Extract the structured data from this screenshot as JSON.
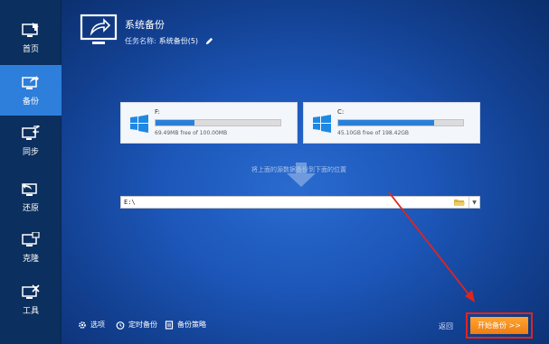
{
  "sidebar": {
    "items": [
      {
        "label": "首页",
        "icon": "home-monitor-icon",
        "active": false
      },
      {
        "label": "备份",
        "icon": "backup-icon",
        "active": true
      },
      {
        "label": "同步",
        "icon": "sync-icon",
        "active": false
      },
      {
        "label": "还原",
        "icon": "restore-icon",
        "active": false
      },
      {
        "label": "克隆",
        "icon": "clone-icon",
        "active": false
      },
      {
        "label": "工具",
        "icon": "tools-icon",
        "active": false
      }
    ]
  },
  "header": {
    "title": "系统备份",
    "task_name_label": "任务名称:",
    "task_name_value": "系统备份(5)"
  },
  "sources": [
    {
      "letter": "F:",
      "free_text": "69.49MB free of 100.00MB",
      "used_fraction": 0.31
    },
    {
      "letter": "C:",
      "free_text": "45.10GB free of 198.42GB",
      "used_fraction": 0.77
    }
  ],
  "hint": "将上面的源数据备份到下面的位置",
  "destination": {
    "path": "E:\\"
  },
  "bottom": {
    "options_label": "选项",
    "schedule_label": "定时备份",
    "strategy_label": "备份策略",
    "back_label": "返回",
    "start_label": "开始备份 >>"
  },
  "colors": {
    "accent_orange": "#f39020",
    "active_nav": "#2d7fdb",
    "progress": "#2a80d8",
    "annotation_red": "#e0251d"
  }
}
